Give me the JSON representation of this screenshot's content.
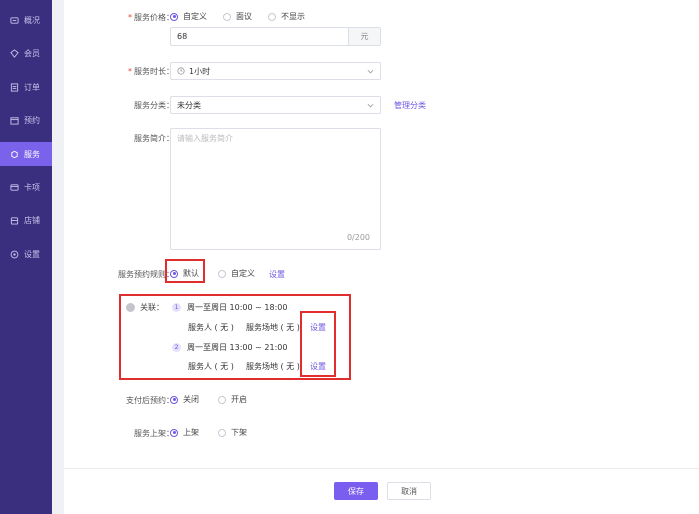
{
  "sidebar": {
    "items": [
      {
        "label": "概况",
        "icon": "overview-icon"
      },
      {
        "label": "会员",
        "icon": "member-icon"
      },
      {
        "label": "订单",
        "icon": "order-icon"
      },
      {
        "label": "预约",
        "icon": "booking-icon"
      },
      {
        "label": "服务",
        "icon": "service-icon"
      },
      {
        "label": "卡项",
        "icon": "card-icon"
      },
      {
        "label": "店铺",
        "icon": "store-icon"
      },
      {
        "label": "设置",
        "icon": "settings-icon"
      }
    ],
    "active_index": 4
  },
  "form": {
    "price": {
      "label": "服务价格：",
      "options": [
        "自定义",
        "面议",
        "不显示"
      ],
      "selected": "自定义",
      "value": "68",
      "unit": "元"
    },
    "duration": {
      "label": "服务时长：",
      "value": "1小时"
    },
    "category": {
      "label": "服务分类：",
      "value": "未分类",
      "manage_link": "管理分类"
    },
    "intro": {
      "label": "服务简介：",
      "placeholder": "请输入服务简介",
      "counter": "0/200"
    },
    "booking_rule": {
      "label": "服务预约规则：",
      "options": [
        "默认",
        "自定义"
      ],
      "selected": "默认",
      "settings_link": "设置"
    },
    "association": {
      "label": "关联：",
      "slots": [
        {
          "index": "1",
          "time": "周一至周日 10:00 ~ 18:00",
          "staff": "服务人 ( 无 )",
          "venue": "服务场地 ( 无 )",
          "settings_link": "设置"
        },
        {
          "index": "2",
          "time": "周一至周日 13:00 ~ 21:00",
          "staff": "服务人 ( 无 )",
          "venue": "服务场地 ( 无 )",
          "settings_link": "设置"
        }
      ]
    },
    "pay_after": {
      "label": "支付后预约：",
      "options": [
        "关闭",
        "开启"
      ],
      "selected": "关闭"
    },
    "listing": {
      "label": "服务上架：",
      "options": [
        "上架",
        "下架"
      ],
      "selected": "上架"
    }
  },
  "footer": {
    "save_label": "保存",
    "cancel_label": "取消"
  },
  "colors": {
    "sidebar_bg": "#3a2f7f",
    "accent": "#6e57e0",
    "highlight_box": "#e02d2d"
  }
}
